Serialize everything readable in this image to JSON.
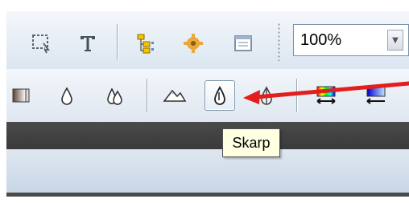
{
  "toolbar": {
    "zoom": {
      "value": "100%",
      "dropdown_icon": "chevron-down-icon"
    },
    "row1_icons": [
      "select-region-icon",
      "text-tool-icon",
      "tree-structure-icon",
      "gear-icon",
      "window-icon"
    ],
    "row2_icons": [
      "gradient-fill-icon",
      "drop-icon",
      "double-drop-icon",
      "mountains-icon",
      "sharpen-icon",
      "half-drop-icon",
      "color-gradient-icon",
      "blue-gradient-icon"
    ]
  },
  "tooltip": {
    "text": "Skarp"
  },
  "annotation": {
    "arrow_color": "#e41d1d"
  }
}
